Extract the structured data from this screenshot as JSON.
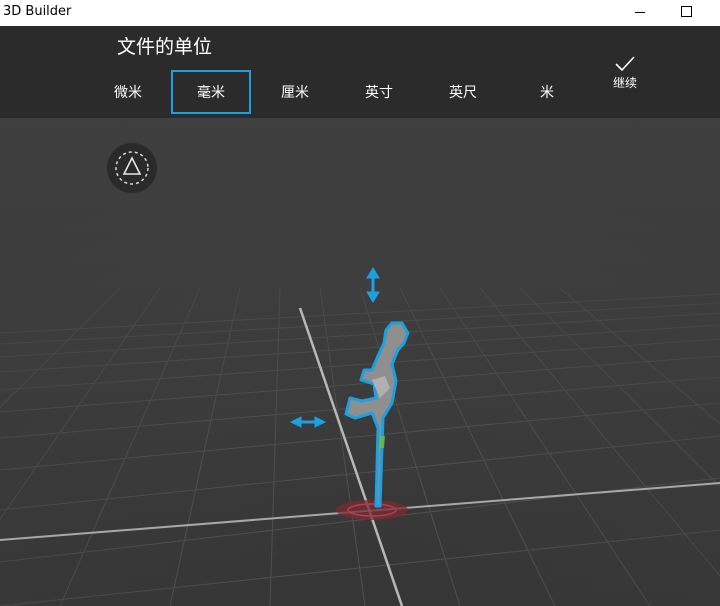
{
  "window": {
    "title": "3D Builder"
  },
  "toolbar": {
    "heading": "文件的单位",
    "units": [
      {
        "label": "微米",
        "selected": false
      },
      {
        "label": "毫米",
        "selected": true
      },
      {
        "label": "厘米",
        "selected": false
      },
      {
        "label": "英寸",
        "selected": false
      },
      {
        "label": "英尺",
        "selected": false
      },
      {
        "label": "米",
        "selected": false
      }
    ],
    "continue_label": "继续",
    "continue_icon": "checkmark-icon"
  },
  "viewport": {
    "view_button_icon": "triangle-view-icon",
    "move_vertical_icon": "vertical-arrow-icon",
    "move_horizontal_icon": "horizontal-arrow-icon",
    "model": "dinosaur",
    "colors": {
      "accent": "#1ba1e2",
      "grid_line": "#5a5a5a",
      "axis": "#bdbdbd",
      "base_ring": "#8a2d35"
    }
  }
}
